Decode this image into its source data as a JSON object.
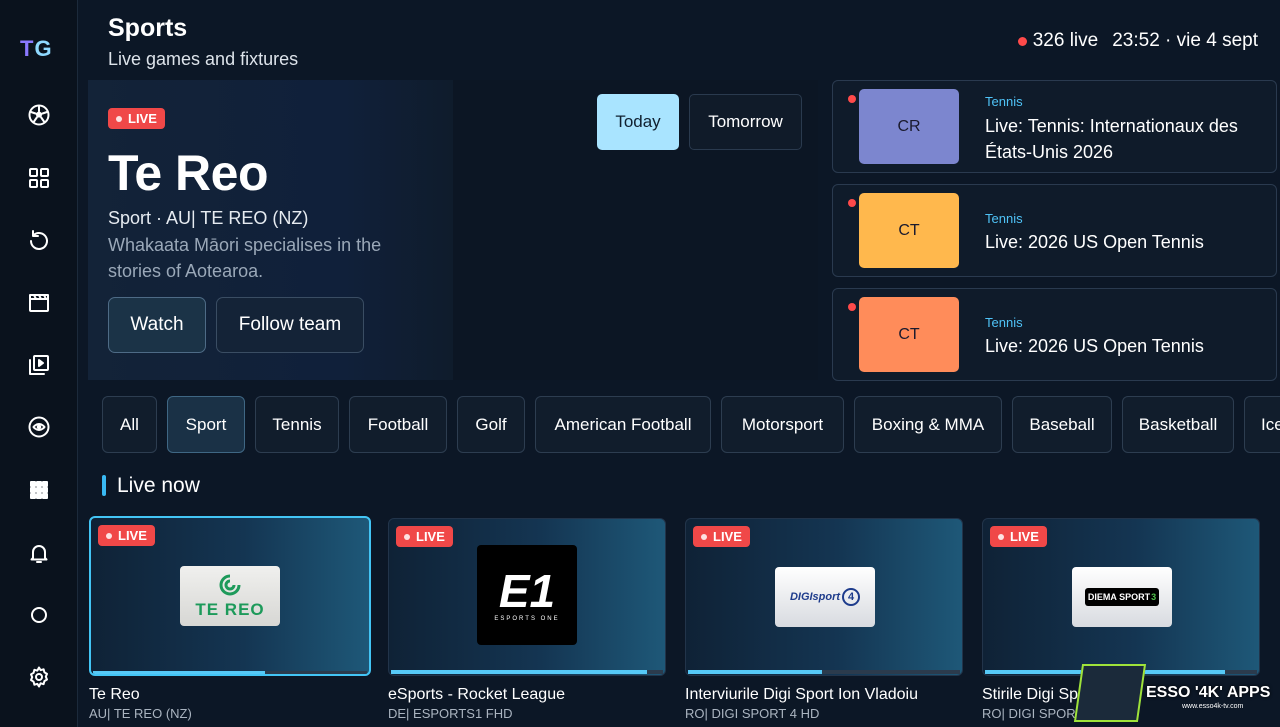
{
  "app": {
    "logo_t": "T",
    "logo_g": "G"
  },
  "sidebar": {
    "items": [
      {
        "icon": "soccer-ball-icon"
      },
      {
        "icon": "grid-icon"
      },
      {
        "icon": "replay-icon"
      },
      {
        "icon": "clapperboard-icon"
      },
      {
        "icon": "playlist-icon"
      },
      {
        "icon": "eye-icon"
      },
      {
        "icon": "apps-icon"
      },
      {
        "icon": "bell-icon"
      },
      {
        "icon": "circle-icon"
      },
      {
        "icon": "gear-icon"
      }
    ]
  },
  "header": {
    "title": "Sports",
    "subtitle": "Live games and fixtures",
    "live_count": "326 live",
    "clock": "23:52 · vie 4 sept"
  },
  "hero": {
    "badge": "LIVE",
    "title": "Te Reo",
    "meta": "Sport · AU| TE REO (NZ)",
    "description": "Whakaata Māori specialises in the stories of Aotearoa.",
    "watch_label": "Watch",
    "follow_label": "Follow team",
    "tabs": [
      {
        "label": "Today",
        "active": true
      },
      {
        "label": "Tomorrow",
        "active": false
      }
    ]
  },
  "events": [
    {
      "abbr": "CR",
      "category": "Tennis",
      "title": "Live: Tennis: Internationaux des États-Unis 2026",
      "color": "#7c86cf"
    },
    {
      "abbr": "CT",
      "category": "Tennis",
      "title": "Live: 2026 US Open Tennis",
      "color": "#ffb84d"
    },
    {
      "abbr": "CT",
      "category": "Tennis",
      "title": "Live: 2026 US Open Tennis",
      "color": "#ff8c5a"
    }
  ],
  "chips": [
    "All",
    "Sport",
    "Tennis",
    "Football",
    "Golf",
    "American Football",
    "Motorsport",
    "Boxing & MMA",
    "Baseball",
    "Basketball",
    "Ice Hockey"
  ],
  "active_chip": "Sport",
  "section_title": "Live now",
  "live_cards": [
    {
      "badge": "LIVE",
      "title": "Te Reo",
      "subtitle": "AU| TE REO (NZ)",
      "logo_text": "TE REO",
      "progress": 0.62
    },
    {
      "badge": "LIVE",
      "title": "eSports - Rocket League",
      "subtitle": "DE| ESPORTS1 FHD",
      "logo_text": "E1",
      "logo_sub": "ESPORTS ONE",
      "progress": 0.93
    },
    {
      "badge": "LIVE",
      "title": "Interviurile Digi Sport Ion Vladoiu",
      "subtitle": "RO| DIGI SPORT 4 HD",
      "logo_text": "DIGIsport",
      "logo_num": "4",
      "progress": 0.49
    },
    {
      "badge": "LIVE",
      "title": "Stirile Digi Sport",
      "subtitle": "RO| DIGI SPORT 3 HD",
      "logo_text": "DIEMA SPORT",
      "logo_num": "3",
      "progress": 0.88
    }
  ],
  "watermark": {
    "text": "ESSO '4K' APPS",
    "url": "www.esso4k-tv.com"
  },
  "colors": {
    "accent": "#43c5f5",
    "live": "#f04848",
    "today_tab": "#a9e4ff"
  }
}
